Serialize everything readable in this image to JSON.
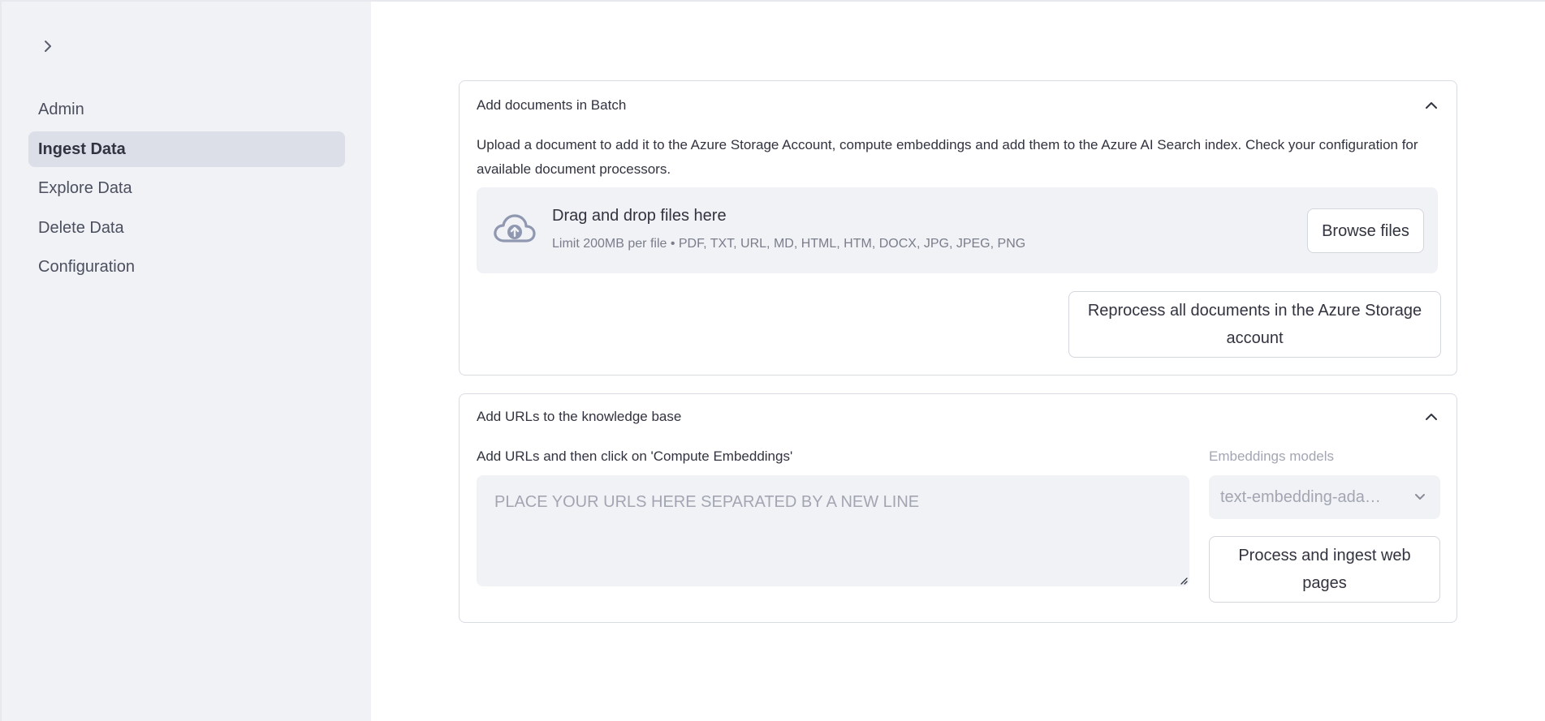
{
  "sidebar": {
    "items": [
      {
        "label": "Admin"
      },
      {
        "label": "Ingest Data"
      },
      {
        "label": "Explore Data"
      },
      {
        "label": "Delete Data"
      },
      {
        "label": "Configuration"
      }
    ],
    "active_index": 1
  },
  "batch_card": {
    "title": "Add documents in Batch",
    "description": "Upload a document to add it to the Azure Storage Account, compute embeddings and add them to the Azure AI Search index. Check your configuration for available document processors.",
    "dropzone": {
      "title": "Drag and drop files here",
      "subtitle": "Limit 200MB per file • PDF, TXT, URL, MD, HTML, HTM, DOCX, JPG, JPEG, PNG",
      "browse_label": "Browse files"
    },
    "reprocess_label": "Reprocess all documents in the Azure Storage account"
  },
  "urls_card": {
    "title": "Add URLs to the knowledge base",
    "urls_label": "Add URLs and then click on 'Compute Embeddings'",
    "urls_placeholder": "PLACE YOUR URLS HERE SEPARATED BY A NEW LINE",
    "urls_value": "",
    "embeddings_label": "Embeddings models",
    "embeddings_selected": "text-embedding-ada…",
    "process_label": "Process and ingest web pages"
  },
  "colors": {
    "sidebar_bg": "#f0f2f6",
    "active_nav_bg": "#dcdfe8",
    "text": "#31333f",
    "muted": "#a3a6b2",
    "border": "#dadce4"
  }
}
